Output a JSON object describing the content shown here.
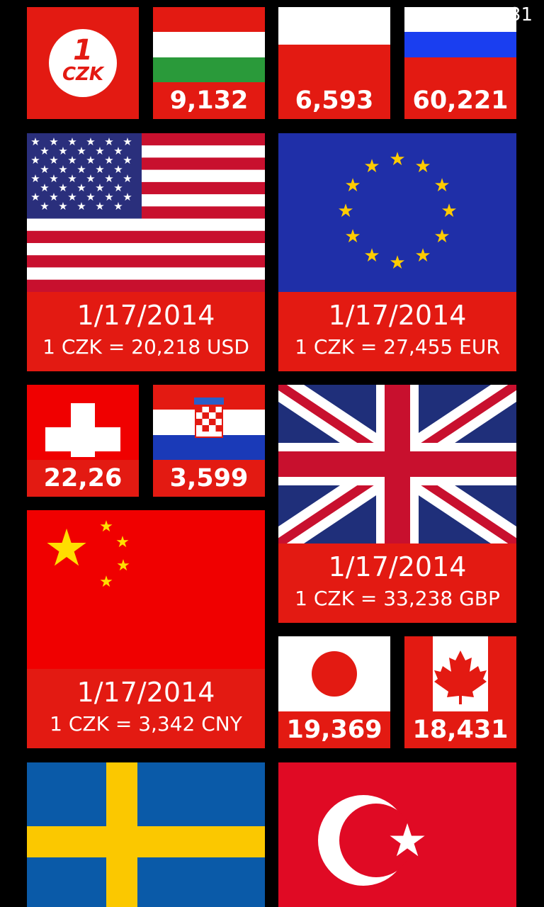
{
  "status_bar": {
    "time": "1:31"
  },
  "app_tile": {
    "amount": "1",
    "code": "CZK"
  },
  "tiles": {
    "huf": {
      "value": "9,132"
    },
    "pln": {
      "value": "6,593"
    },
    "rub": {
      "value": "60,221"
    },
    "usd": {
      "date": "1/17/2014",
      "rate": "1 CZK = 20,218 USD"
    },
    "eur": {
      "date": "1/17/2014",
      "rate": "1 CZK = 27,455 EUR"
    },
    "chf": {
      "value": "22,26"
    },
    "hrk": {
      "value": "3,599"
    },
    "gbp": {
      "date": "1/17/2014",
      "rate": "1 CZK = 33,238 GBP"
    },
    "cny": {
      "date": "1/17/2014",
      "rate": "1 CZK = 3,342 CNY"
    },
    "jpy": {
      "value": "19,369"
    },
    "cad": {
      "value": "18,431"
    }
  },
  "colors": {
    "tile_red": "#e31a12",
    "background": "#000000"
  }
}
